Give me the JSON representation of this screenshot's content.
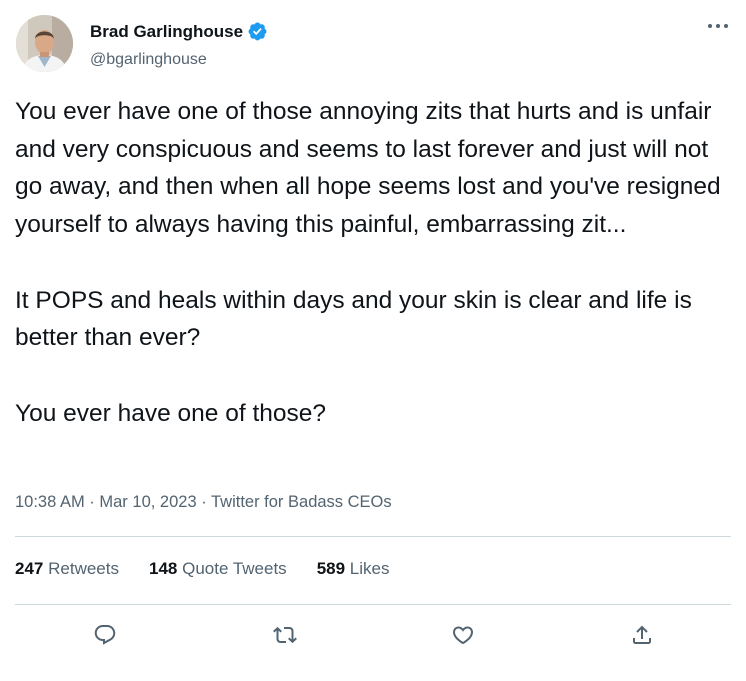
{
  "author": {
    "name": "Brad Garlinghouse",
    "handle": "@bgarlinghouse"
  },
  "icons": {
    "avatar": "profile-photo",
    "verified": "verified-badge-icon",
    "more": "more-horizontal-icon",
    "reply": "reply-icon",
    "retweet": "retweet-icon",
    "like": "heart-icon",
    "share": "share-icon"
  },
  "colors": {
    "verified": "#1d9bf0",
    "text": "#0f1419",
    "secondary": "#536471",
    "divider": "#cfd9de"
  },
  "tweet": {
    "paragraphs": [
      "You ever have one of those annoying zits that hurts and is unfair and very conspicuous and seems to last forever and just will not go away, and then when all hope seems lost and you've resigned yourself to always having this painful, embarrassing zit...",
      "It POPS and heals within days and your skin is clear and life is better than ever?",
      "You ever have one of those?"
    ],
    "time": "10:38 AM",
    "separator": " · ",
    "date": "Mar 10, 2023",
    "source": "Twitter for Badass CEOs"
  },
  "stats": {
    "retweets_count": "247",
    "retweets_label": "Retweets",
    "quotes_count": "148",
    "quotes_label": "Quote Tweets",
    "likes_count": "589",
    "likes_label": "Likes"
  }
}
